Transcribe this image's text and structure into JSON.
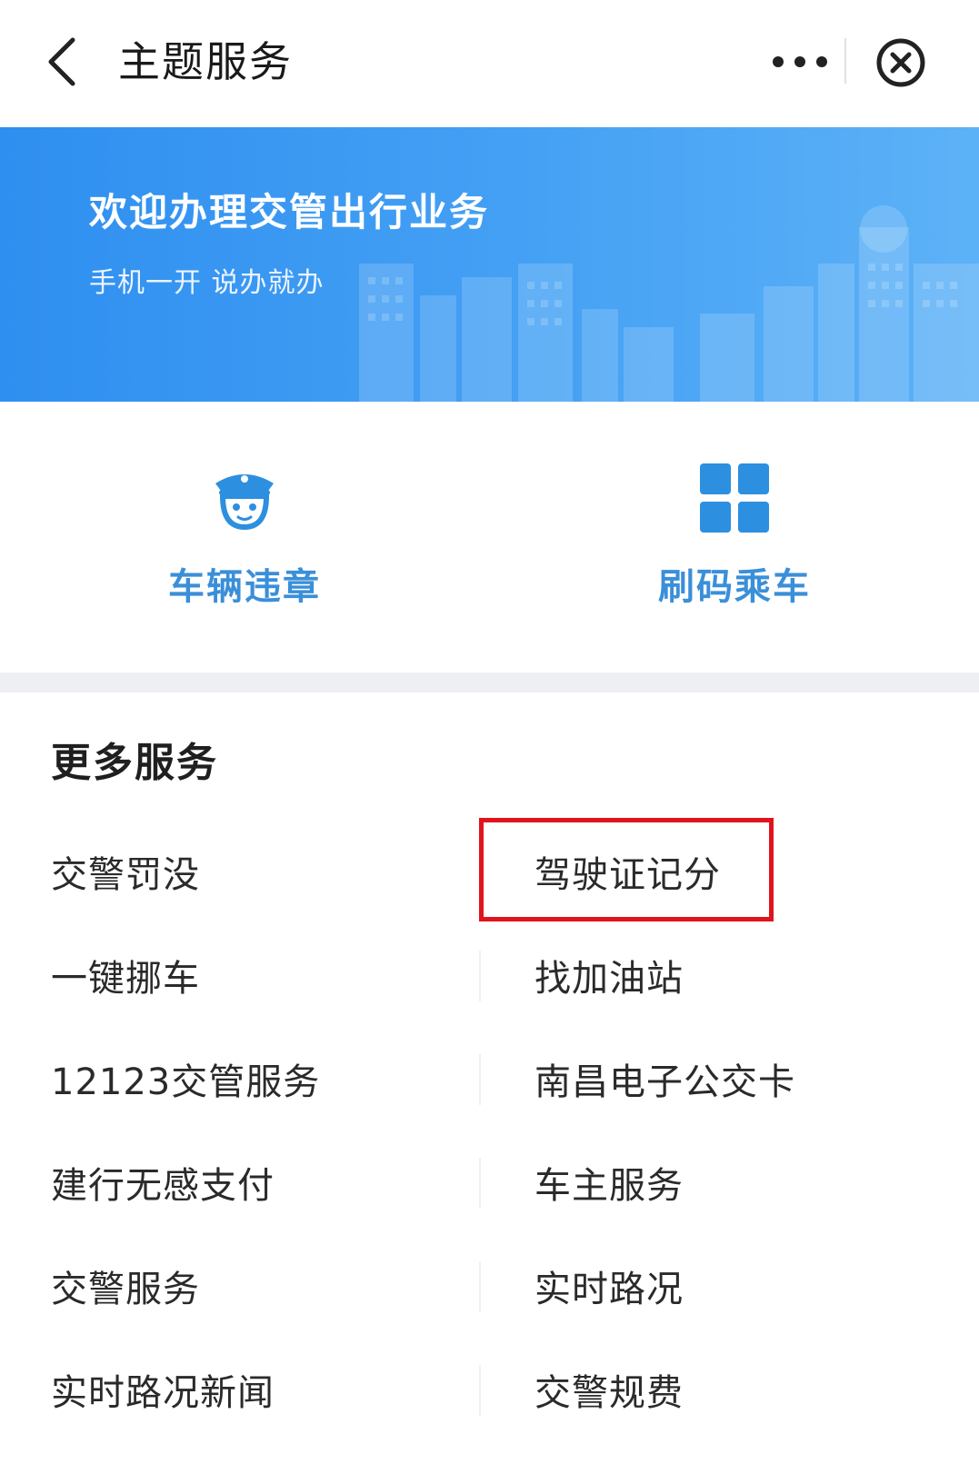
{
  "header": {
    "title": "主题服务",
    "back_icon": "chevron-left-icon",
    "more_icon": "more-dots-icon",
    "close_icon": "close-circle-icon"
  },
  "banner": {
    "title": "欢迎办理交管出行业务",
    "subtitle": "手机一开 说办就办",
    "background_color": "#3a98f2"
  },
  "quick_entries": [
    {
      "label": "车辆违章",
      "icon": "police-officer-icon"
    },
    {
      "label": "刷码乘车",
      "icon": "grid-squares-icon"
    }
  ],
  "quick_accent_color": "#3a8fd9",
  "more_services": {
    "title": "更多服务",
    "items_left": [
      "交警罚没",
      "一键挪车",
      "12123交管服务",
      "建行无感支付",
      "交警服务",
      "实时路况新闻"
    ],
    "items_right": [
      "驾驶证记分",
      "找加油站",
      "南昌电子公交卡",
      "车主服务",
      "实时路况",
      "交警规费"
    ],
    "highlighted_item": "驾驶证记分",
    "highlight_color": "#e0141d"
  }
}
